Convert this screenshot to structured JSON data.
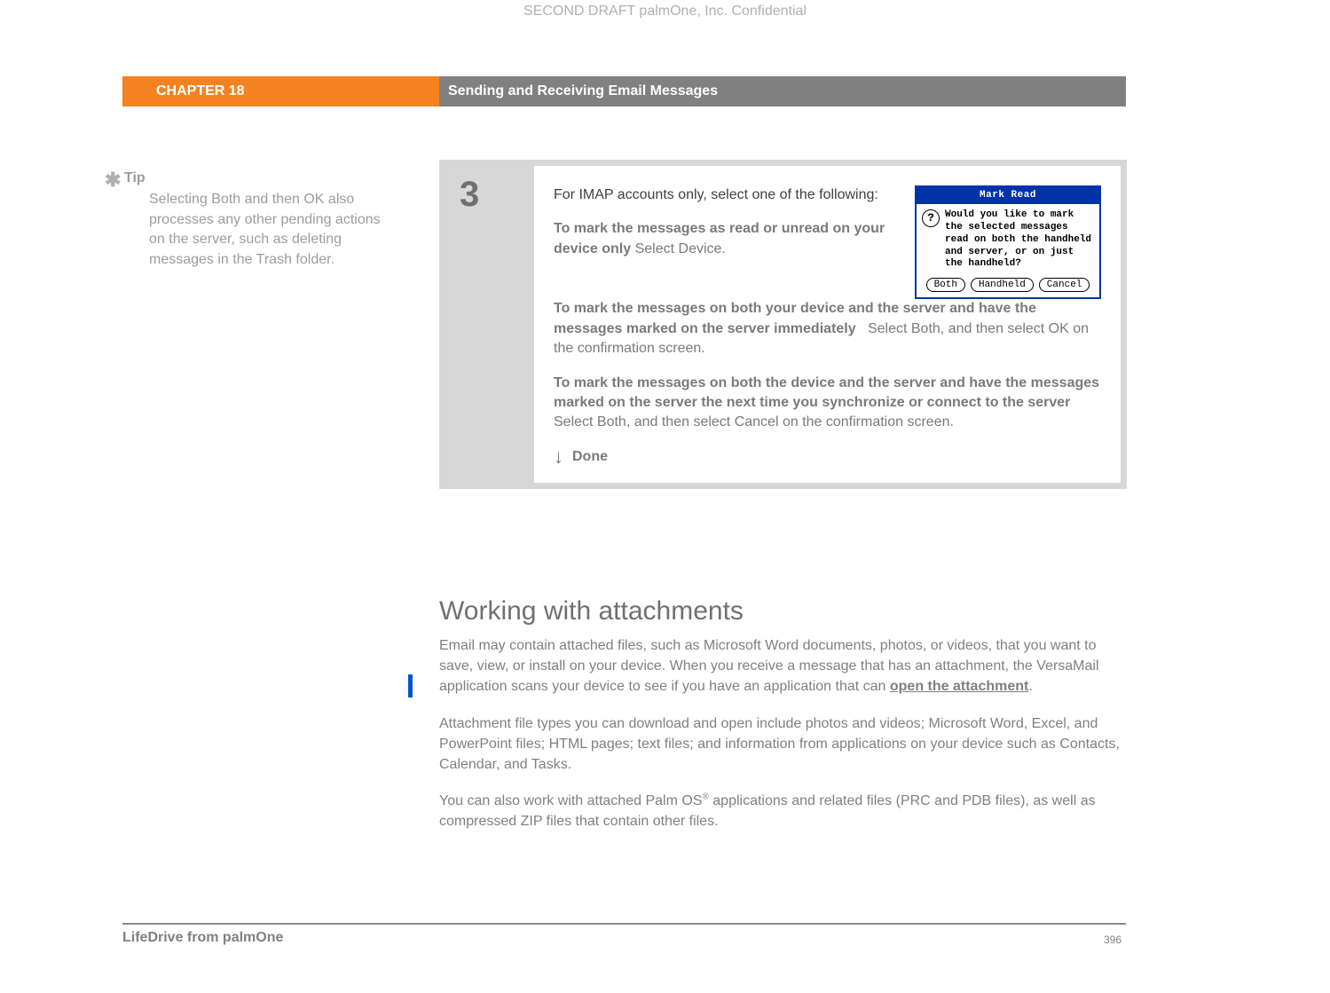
{
  "watermark": "SECOND DRAFT palmOne, Inc.  Confidential",
  "banner": {
    "chapter": "CHAPTER 18",
    "title": "Sending and Receiving Email Messages"
  },
  "tip": {
    "label": "Tip",
    "body": "Selecting Both and then OK also processes any other pending actions on the server, such as deleting messages in the Trash folder."
  },
  "step": {
    "number": "3",
    "intro": "For IMAP accounts only, select one of the following:",
    "opt1_bold": "To mark the messages as read or unread on your device only",
    "opt1_rest": "Select Device.",
    "opt2_bold": "To mark the messages on both your device and the server and have the messages marked on the server immediately",
    "opt2_rest": "Select Both, and then select OK on the confirmation screen.",
    "opt3_bold": "To mark the messages on both the device and the server and have the messages marked on the server the next time you synchronize or connect to the server",
    "opt3_rest": "Select Both, and then select Cancel on the confirmation screen.",
    "done": "Done"
  },
  "dialog": {
    "title": "Mark Read",
    "message": "Would you like to mark the selected messages read on both the handheld and server, or on just the handheld?",
    "buttons": {
      "both": "Both",
      "handheld": "Handheld",
      "cancel": "Cancel"
    }
  },
  "heading": "Working with attachments",
  "body": {
    "p1a": "Email may contain attached files, such as Microsoft Word documents, photos, or videos, that you want to save, view, or install on your device. When you receive a message that has an attachment, the VersaMail application scans your device to see if you have an application that can ",
    "p1_link": "open the attachment",
    "p1b": ".",
    "p2": "Attachment file types you can download and open include photos and videos; Microsoft Word, Excel, and PowerPoint files; HTML pages; text files; and information from applications on your device such as Contacts, Calendar, and Tasks.",
    "p3a": "You can also work with attached Palm OS",
    "p3_sup": "®",
    "p3b": " applications and related files (PRC and PDB files), as well as compressed ZIP files that contain other files."
  },
  "footer": {
    "left": "LifeDrive from palmOne",
    "page": "396"
  }
}
